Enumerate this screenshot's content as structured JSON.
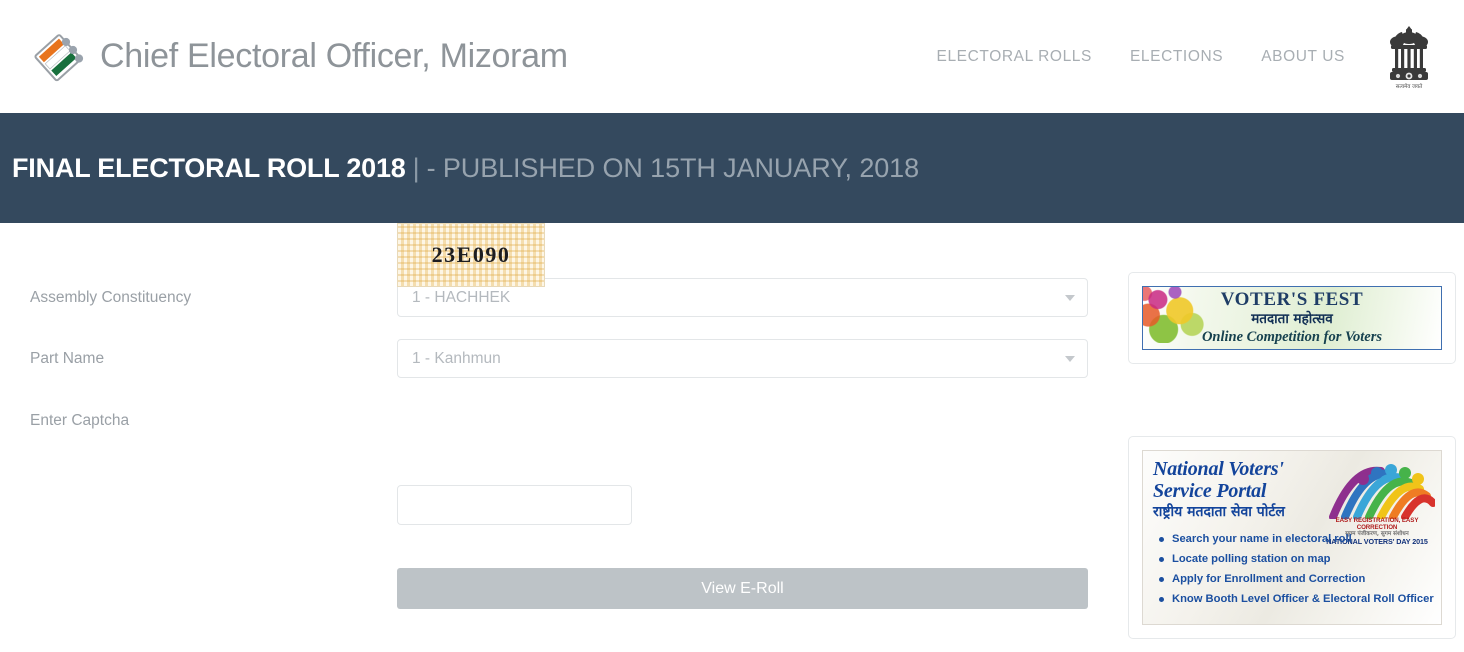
{
  "header": {
    "brand_title": "Chief Electoral Officer, Mizoram",
    "logo_name": "eci-ballot-logo",
    "emblem_name": "ashoka-emblem",
    "emblem_motto": "सत्यमेव जयते",
    "nav": [
      {
        "label": "ELECTORAL ROLLS",
        "name": "nav-electoral-rolls"
      },
      {
        "label": "ELECTIONS",
        "name": "nav-elections"
      },
      {
        "label": "ABOUT US",
        "name": "nav-about-us"
      }
    ]
  },
  "banner": {
    "title": "FINAL ELECTORAL ROLL 2018",
    "separator": "|",
    "subtitle": "- PUBLISHED ON 15TH JANUARY, 2018",
    "background_color": "#34495e",
    "title_color": "#ffffff",
    "subtitle_color": "#97a3ae"
  },
  "form": {
    "assembly_constituency": {
      "label": "Assembly Constituency",
      "value": "1 - HACHHEK"
    },
    "part_name": {
      "label": "Part Name",
      "value": "1 - Kanhmun"
    },
    "captcha": {
      "label": "Enter Captcha",
      "image_text": "23E090",
      "input_value": "",
      "input_placeholder": ""
    },
    "submit_label": "View E-Roll",
    "submit_color": "#bdc3c7"
  },
  "sidebar": {
    "voters_fest": {
      "name": "voters-fest-banner",
      "line1": "VOTER'S FEST",
      "line2": "मतदाता  महोत्सव",
      "line3": "Online Competition for Voters"
    },
    "nvsp": {
      "name": "nvsp-banner",
      "title_line1": "National Voters'",
      "title_line2": "Service Portal",
      "title_hindi": "राष्ट्रीय मतदाता सेवा पोर्टल",
      "tagline_en": "EASY REGISTRATION, EASY CORRECTION",
      "tagline_hi": "सुगम पंजीकरण, सुगम संशोधन",
      "tagline_day": "NATIONAL VOTERS' DAY 2015",
      "bullets": [
        "Search your name in electoral roll",
        "Locate polling station on map",
        "Apply for Enrollment and Correction",
        "Know Booth Level Officer & Electoral Roll Officer"
      ]
    }
  }
}
